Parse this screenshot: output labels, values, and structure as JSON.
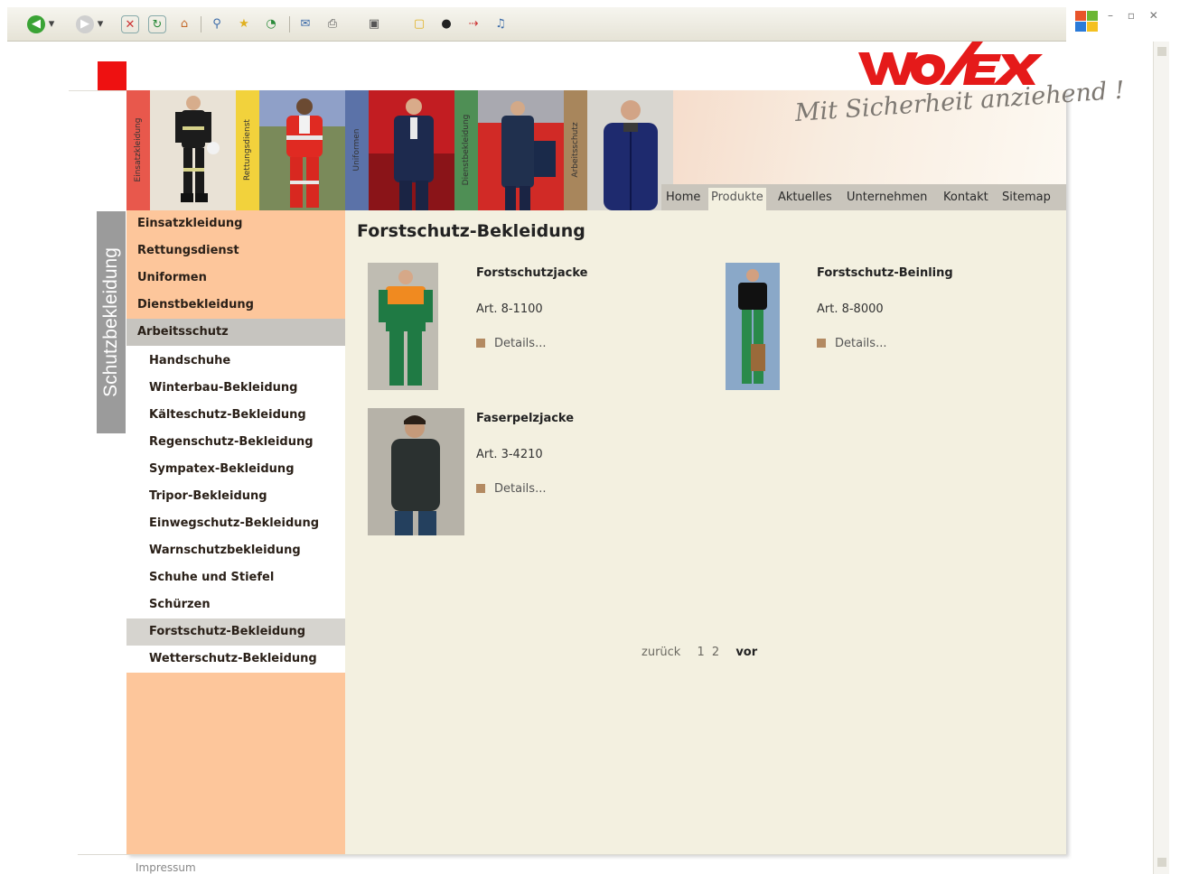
{
  "browser": {
    "toolbar_icons": [
      "back-icon",
      "forward-icon",
      "stop-icon",
      "refresh-icon",
      "home-icon",
      "search-icon",
      "favorites-icon",
      "history-icon",
      "mail-icon",
      "print-icon",
      "edit-icon",
      "notes-icon",
      "messenger-icon",
      "research-icon",
      "media-icon"
    ]
  },
  "brand": {
    "logo": "wolfex",
    "accent_red": "#ee1111",
    "nav_orange": "#fdc69b",
    "content_bg": "#f3f0e0"
  },
  "header": {
    "slogan": "Mit Sicherheit anziehend !",
    "category_tabs": [
      {
        "label": "Einsatzkleidung",
        "color": "#e8584c"
      },
      {
        "label": "Rettungsdienst",
        "color": "#f2d23c"
      },
      {
        "label": "Uniformen",
        "color": "#5b72a8"
      },
      {
        "label": "Dienstbekleidung",
        "color": "#4f8f55"
      },
      {
        "label": "Arbeitsschutz",
        "color": "#a8865c"
      }
    ],
    "nav": [
      {
        "label": "Home"
      },
      {
        "label": "Produkte"
      },
      {
        "label": "Aktuelles"
      },
      {
        "label": "Unternehmen"
      },
      {
        "label": "Kontakt"
      },
      {
        "label": "Sitemap"
      }
    ]
  },
  "section_label": "Schutzbekleidung",
  "sidebar": {
    "main_items": [
      {
        "label": "Einsatzkleidung"
      },
      {
        "label": "Rettungsdienst"
      },
      {
        "label": "Uniformen"
      },
      {
        "label": "Dienstbekleidung"
      },
      {
        "label": "Arbeitsschutz"
      }
    ],
    "sub_items": [
      {
        "label": "Handschuhe"
      },
      {
        "label": "Winterbau-Bekleidung"
      },
      {
        "label": "Kälteschutz-Bekleidung"
      },
      {
        "label": "Regenschutz-Bekleidung"
      },
      {
        "label": "Sympatex-Bekleidung"
      },
      {
        "label": "Tripor-Bekleidung"
      },
      {
        "label": "Einwegschutz-Bekleidung"
      },
      {
        "label": "Warnschutzbekleidung"
      },
      {
        "label": "Schuhe und Stiefel"
      },
      {
        "label": "Schürzen"
      },
      {
        "label": "Forstschutz-Bekleidung"
      },
      {
        "label": "Wetterschutz-Bekleidung"
      }
    ]
  },
  "main": {
    "title": "Forstschutz-Bekleidung",
    "products": [
      {
        "name": "Forstschutzjacke",
        "art": "Art. 8-1100",
        "details": "Details..."
      },
      {
        "name": "Forstschutz-Beinling",
        "art": "Art. 8-8000",
        "details": "Details..."
      },
      {
        "name": "Faserpelzjacke",
        "art": "Art. 3-4210",
        "details": "Details..."
      }
    ],
    "pager": {
      "prev": "zurück",
      "page1": "1",
      "page2": "2",
      "next": "vor"
    }
  },
  "footer": {
    "impressum": "Impressum"
  }
}
